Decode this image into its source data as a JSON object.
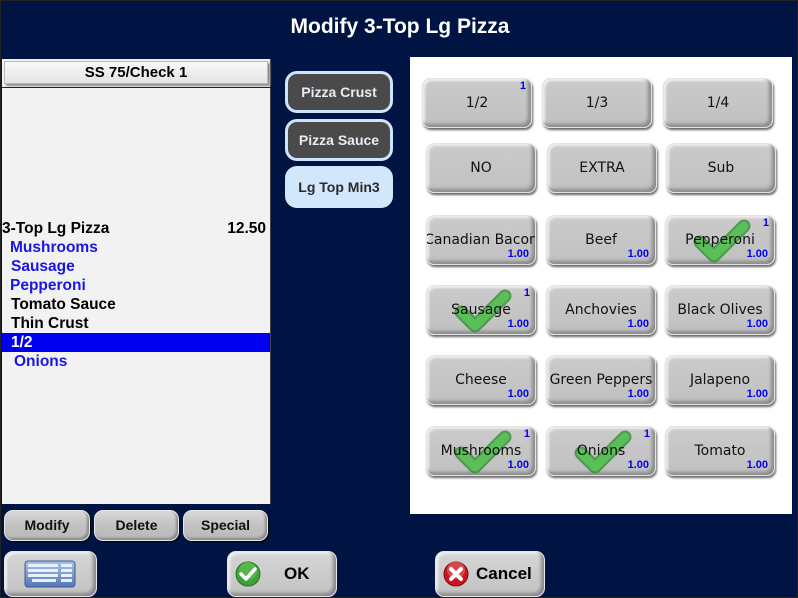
{
  "title": "Modify 3-Top Lg Pizza",
  "check": {
    "header": "SS 75/Check 1",
    "lines": [
      {
        "text": "3-Top Lg Pizza",
        "price": "12.50",
        "kind": "item"
      },
      {
        "text": "Mushrooms",
        "kind": "mod-blue",
        "indent": 1
      },
      {
        "text": "Sausage",
        "kind": "mod-blue",
        "indent": 1
      },
      {
        "text": "Pepperoni",
        "kind": "mod-blue",
        "indent": 1
      },
      {
        "text": "Tomato Sauce",
        "kind": "mod-black",
        "indent": 1
      },
      {
        "text": "Thin Crust",
        "kind": "mod-black",
        "indent": 1
      },
      {
        "text": "1/2",
        "kind": "sel",
        "indent": 1,
        "selected": true
      },
      {
        "text": "Onions",
        "kind": "mod-blue",
        "indent": 2
      }
    ]
  },
  "line_actions": {
    "modify": "Modify",
    "delete": "Delete",
    "special": "Special"
  },
  "categories": [
    {
      "label": "Pizza Crust",
      "active": false
    },
    {
      "label": "Pizza Sauce",
      "active": false
    },
    {
      "label": "Lg Top Min3",
      "active": true
    }
  ],
  "portions": [
    {
      "label": "1/2",
      "count": "1"
    },
    {
      "label": "1/3",
      "count": ""
    },
    {
      "label": "1/4",
      "count": ""
    }
  ],
  "prefixes": [
    {
      "label": "NO"
    },
    {
      "label": "EXTRA"
    },
    {
      "label": "Sub"
    }
  ],
  "toppings": [
    {
      "label": "Canadian Bacon",
      "price": "1.00",
      "count": "",
      "checked": false
    },
    {
      "label": "Beef",
      "price": "1.00",
      "count": "",
      "checked": false
    },
    {
      "label": "Pepperoni",
      "price": "1.00",
      "count": "1",
      "checked": true
    },
    {
      "label": "Sausage",
      "price": "1.00",
      "count": "1",
      "checked": true
    },
    {
      "label": "Anchovies",
      "price": "1.00",
      "count": "",
      "checked": false
    },
    {
      "label": "Black Olives",
      "price": "1.00",
      "count": "",
      "checked": false
    },
    {
      "label": "Cheese",
      "price": "1.00",
      "count": "",
      "checked": false
    },
    {
      "label": "Green Peppers",
      "price": "1.00",
      "count": "",
      "checked": false
    },
    {
      "label": "Jalapeno",
      "price": "1.00",
      "count": "",
      "checked": false
    },
    {
      "label": "Mushrooms",
      "price": "1.00",
      "count": "1",
      "checked": true
    },
    {
      "label": "Onions",
      "price": "1.00",
      "count": "1",
      "checked": true
    },
    {
      "label": "Tomato",
      "price": "1.00",
      "count": "",
      "checked": false
    }
  ],
  "footer": {
    "keyboard_icon": "keyboard-icon",
    "ok_label": "OK",
    "ok_icon": "green-check-circle-icon",
    "cancel_label": "Cancel",
    "cancel_icon": "red-x-circle-icon"
  },
  "colors": {
    "background": "#001443",
    "selected_line": "#0000f0",
    "modifier_text": "#1a16e6",
    "count_text": "#0000ee",
    "check_green": "#4caf50"
  }
}
